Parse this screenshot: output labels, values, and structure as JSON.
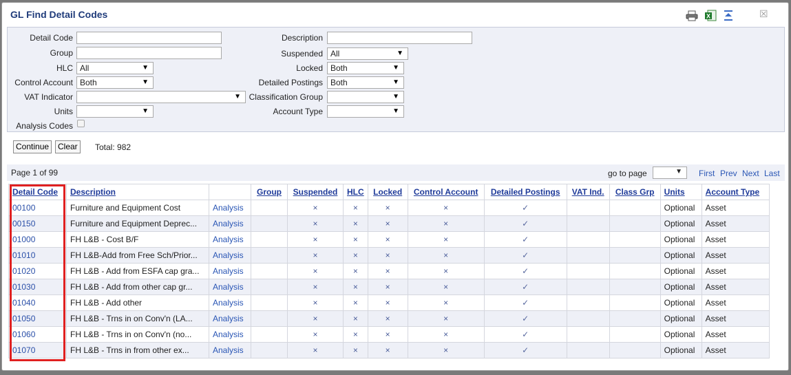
{
  "window": {
    "title": "GL Find Detail Codes",
    "toolbar_icons": [
      "print-icon",
      "excel-export-icon",
      "collapse-filter-icon"
    ],
    "close_label": "☒"
  },
  "filters": {
    "detail_code": {
      "label": "Detail Code",
      "value": ""
    },
    "group": {
      "label": "Group",
      "value": ""
    },
    "hlc": {
      "label": "HLC",
      "value": "All"
    },
    "control_account": {
      "label": "Control Account",
      "value": "Both"
    },
    "vat_indicator": {
      "label": "VAT Indicator",
      "value": ""
    },
    "units": {
      "label": "Units",
      "value": ""
    },
    "analysis_codes": {
      "label": "Analysis Codes",
      "checked": false
    },
    "description": {
      "label": "Description",
      "value": ""
    },
    "suspended": {
      "label": "Suspended",
      "value": "All"
    },
    "locked": {
      "label": "Locked",
      "value": "Both"
    },
    "detailed_postings": {
      "label": "Detailed Postings",
      "value": "Both"
    },
    "classification_group": {
      "label": "Classification Group",
      "value": ""
    },
    "account_type": {
      "label": "Account Type",
      "value": ""
    }
  },
  "actions": {
    "continue_label": "Continue",
    "clear_label": "Clear",
    "total_text": "Total: 982"
  },
  "pager": {
    "page_text": "Page 1 of 99",
    "goto_label": "go to page",
    "goto_value": "",
    "first": "First",
    "prev": "Prev",
    "next": "Next",
    "last": "Last"
  },
  "table": {
    "headers": [
      "Detail Code",
      "Description",
      "",
      "Group",
      "Suspended",
      "HLC",
      "Locked",
      "Control Account",
      "Detailed Postings",
      "VAT Ind.",
      "Class Grp",
      "Units",
      "Account Type"
    ],
    "rows": [
      {
        "code": "00100",
        "description": "Furniture and Equipment Cost",
        "analysis": "Analysis",
        "group": "",
        "suspended": "×",
        "hlc": "×",
        "locked": "×",
        "control": "×",
        "detailed": "✓",
        "vat": "",
        "class": "",
        "units": "Optional",
        "type": "Asset"
      },
      {
        "code": "00150",
        "description": "Furniture and Equipment Deprec...",
        "analysis": "Analysis",
        "group": "",
        "suspended": "×",
        "hlc": "×",
        "locked": "×",
        "control": "×",
        "detailed": "✓",
        "vat": "",
        "class": "",
        "units": "Optional",
        "type": "Asset"
      },
      {
        "code": "01000",
        "description": "FH L&B - Cost B/F",
        "analysis": "Analysis",
        "group": "",
        "suspended": "×",
        "hlc": "×",
        "locked": "×",
        "control": "×",
        "detailed": "✓",
        "vat": "",
        "class": "",
        "units": "Optional",
        "type": "Asset"
      },
      {
        "code": "01010",
        "description": "FH L&B-Add from Free Sch/Prior...",
        "analysis": "Analysis",
        "group": "",
        "suspended": "×",
        "hlc": "×",
        "locked": "×",
        "control": "×",
        "detailed": "✓",
        "vat": "",
        "class": "",
        "units": "Optional",
        "type": "Asset"
      },
      {
        "code": "01020",
        "description": "FH L&B - Add from ESFA cap gra...",
        "analysis": "Analysis",
        "group": "",
        "suspended": "×",
        "hlc": "×",
        "locked": "×",
        "control": "×",
        "detailed": "✓",
        "vat": "",
        "class": "",
        "units": "Optional",
        "type": "Asset"
      },
      {
        "code": "01030",
        "description": "FH L&B - Add from other cap gr...",
        "analysis": "Analysis",
        "group": "",
        "suspended": "×",
        "hlc": "×",
        "locked": "×",
        "control": "×",
        "detailed": "✓",
        "vat": "",
        "class": "",
        "units": "Optional",
        "type": "Asset"
      },
      {
        "code": "01040",
        "description": "FH L&B - Add other",
        "analysis": "Analysis",
        "group": "",
        "suspended": "×",
        "hlc": "×",
        "locked": "×",
        "control": "×",
        "detailed": "✓",
        "vat": "",
        "class": "",
        "units": "Optional",
        "type": "Asset"
      },
      {
        "code": "01050",
        "description": "FH L&B - Trns in on Conv'n (LA...",
        "analysis": "Analysis",
        "group": "",
        "suspended": "×",
        "hlc": "×",
        "locked": "×",
        "control": "×",
        "detailed": "✓",
        "vat": "",
        "class": "",
        "units": "Optional",
        "type": "Asset"
      },
      {
        "code": "01060",
        "description": "FH L&B - Trns in on Conv'n (no...",
        "analysis": "Analysis",
        "group": "",
        "suspended": "×",
        "hlc": "×",
        "locked": "×",
        "control": "×",
        "detailed": "✓",
        "vat": "",
        "class": "",
        "units": "Optional",
        "type": "Asset"
      },
      {
        "code": "01070",
        "description": "FH L&B - Trns in from other ex...",
        "analysis": "Analysis",
        "group": "",
        "suspended": "×",
        "hlc": "×",
        "locked": "×",
        "control": "×",
        "detailed": "✓",
        "vat": "",
        "class": "",
        "units": "Optional",
        "type": "Asset"
      }
    ]
  },
  "colors": {
    "title": "#1f3b7a",
    "link": "#2a56b5",
    "panel_bg": "#eef0f7",
    "highlight": "#e02020"
  }
}
